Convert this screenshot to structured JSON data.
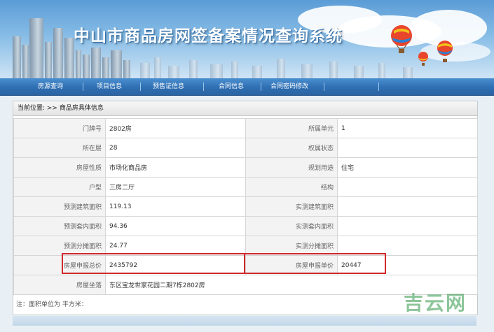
{
  "header": {
    "site_title": "中山市商品房网签备案情况查询系统"
  },
  "nav": {
    "items": [
      {
        "label": "房源查询"
      },
      {
        "label": "项目信息"
      },
      {
        "label": "预售证信息"
      },
      {
        "label": "合同信息"
      },
      {
        "label": "合同密码修改"
      }
    ]
  },
  "breadcrumb": {
    "text": "当前位置: >> 商品房具体信息"
  },
  "details": {
    "rows": [
      {
        "left_label": "门牌号",
        "left_value": "2802房",
        "right_label": "所属单元",
        "right_value": "1"
      },
      {
        "left_label": "所在层",
        "left_value": "28",
        "right_label": "权属状态",
        "right_value": ""
      },
      {
        "left_label": "房屋性质",
        "left_value": "市场化商品房",
        "right_label": "规划用途",
        "right_value": "住宅"
      },
      {
        "left_label": "户型",
        "left_value": "三房二厅",
        "right_label": "结构",
        "right_value": ""
      },
      {
        "left_label": "预测建筑面积",
        "left_value": "119.13",
        "right_label": "实测建筑面积",
        "right_value": ""
      },
      {
        "left_label": "预测套内面积",
        "left_value": "94.36",
        "right_label": "实测套内面积",
        "right_value": ""
      },
      {
        "left_label": "预测分摊面积",
        "left_value": "24.77",
        "right_label": "实测分摊面积",
        "right_value": ""
      },
      {
        "left_label": "房屋申报总价",
        "left_value": "2435792",
        "right_label": "房屋申报单价",
        "right_value": "20447"
      }
    ],
    "address_label": "房屋坐落",
    "address_value": "东区宝龙世家花园二期7栋2802房"
  },
  "footnote": "注：面积单位为 平方米：",
  "watermark": "吉云网",
  "colors": {
    "nav_bar": "#2f6fb3",
    "highlight": "#d0292b",
    "label_bg": "#f3f3f3"
  }
}
